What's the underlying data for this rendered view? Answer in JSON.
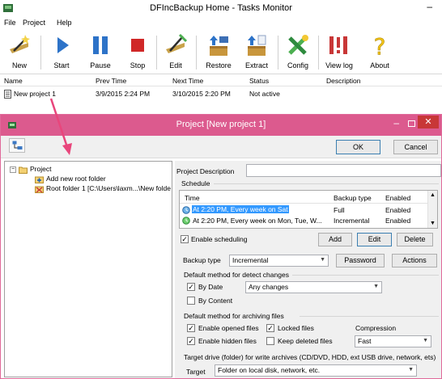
{
  "window": {
    "title": "DFIncBackup Home - Tasks Monitor",
    "minimize_glyph": "–"
  },
  "menu": [
    "File",
    "Project",
    "Help"
  ],
  "toolbar": {
    "buttons": [
      {
        "label": "New",
        "icon": "new-wand-icon"
      },
      {
        "label": "Start",
        "icon": "play-icon"
      },
      {
        "label": "Pause",
        "icon": "pause-icon"
      },
      {
        "label": "Stop",
        "icon": "stop-icon"
      },
      {
        "label": "Edit",
        "icon": "edit-wand-icon"
      },
      {
        "label": "Restore",
        "icon": "restore-icon"
      },
      {
        "label": "Extract",
        "icon": "extract-icon"
      },
      {
        "label": "Config",
        "icon": "config-tools-icon"
      },
      {
        "label": "View log",
        "icon": "view-log-icon"
      },
      {
        "label": "About",
        "icon": "question-icon"
      }
    ]
  },
  "tasks_list": {
    "columns": [
      "Name",
      "Prev Time",
      "Next Time",
      "Status",
      "Description"
    ],
    "rows": [
      {
        "name": "New project 1",
        "prev_time": "3/9/2015 2:24 PM",
        "next_time": "3/10/2015 2:20 PM",
        "status": "Not active",
        "description": ""
      }
    ]
  },
  "dialog": {
    "title": "Project [New project 1]",
    "ok_label": "OK",
    "cancel_label": "Cancel",
    "close_glyph": "✕",
    "min_glyph": "–",
    "tree": {
      "root": "Project",
      "expander": "−",
      "children": [
        "Add new root folder",
        "Root folder 1 [C:\\Users\\laxm...\\New folde"
      ]
    },
    "project_description_label": "Project Description",
    "project_description_value": "",
    "schedule": {
      "group_label": "Schedule",
      "columns": [
        "Time",
        "Backup type",
        "Enabled"
      ],
      "rows": [
        {
          "time": "At 2:20 PM, Every week on Sat",
          "type": "Full",
          "enabled": "Enabled"
        },
        {
          "time": "At 2:20 PM, Every week on Mon, Tue, W...",
          "type": "Incremental",
          "enabled": "Enabled"
        }
      ],
      "enable_scheduling_label": "Enable scheduling",
      "enable_scheduling_checked": true,
      "add_label": "Add",
      "edit_label": "Edit",
      "delete_label": "Delete"
    },
    "backup_type": {
      "label": "Backup type",
      "value": "Incremental",
      "password_label": "Password",
      "actions_label": "Actions"
    },
    "detect_changes": {
      "group_label": "Default method for detect changes",
      "by_date_label": "By Date",
      "by_date_checked": true,
      "by_date_option": "Any changes",
      "by_content_label": "By Content",
      "by_content_checked": false
    },
    "archiving": {
      "group_label": "Default method for archiving files",
      "enable_opened_label": "Enable opened files",
      "enable_opened_checked": true,
      "locked_files_label": "Locked files",
      "locked_files_checked": true,
      "compression_label": "Compression",
      "enable_hidden_label": "Enable hidden files",
      "enable_hidden_checked": true,
      "keep_deleted_label": "Keep deleted files",
      "keep_deleted_checked": false,
      "compression_value": "Fast"
    },
    "target": {
      "group_label": "Target drive (folder) for write archives (CD/DVD, HDD, ext USB drive, network, ets)",
      "label": "Target",
      "value": "Folder on local disk, network, etc."
    }
  },
  "colors": {
    "dialog_titlebar": "#dc5a8e",
    "dialog_close": "#c83737",
    "selection": "#3399ff",
    "annotation_arrow": "#e8467c"
  }
}
